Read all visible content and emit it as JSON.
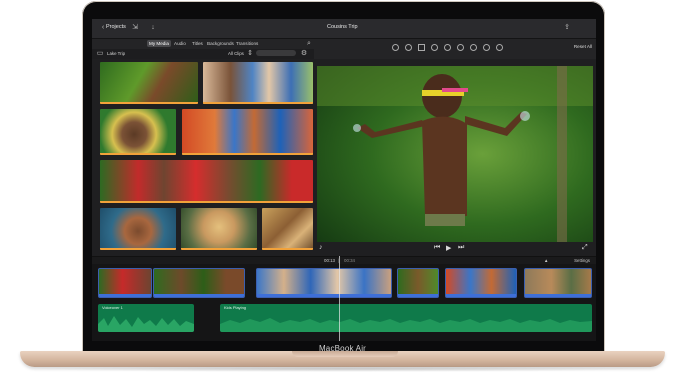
{
  "device": {
    "label": "MacBook Air"
  },
  "titlebar": {
    "back_label": "Projects",
    "project_title": "Cousins Trip",
    "reset_label": "Reset All"
  },
  "media_tabs": [
    "My Media",
    "Audio",
    "Titles",
    "Backgrounds",
    "Transitions"
  ],
  "library": {
    "name": "Lake Trip",
    "filter_label": "All Clips"
  },
  "playback": {
    "current": "00:13",
    "total": "00:34"
  },
  "timeline": {
    "settings_label": "Settings",
    "audio_tracks": [
      "Voiceover 1",
      "Kids Playing"
    ]
  },
  "colors": {
    "accent": "#f2a23a",
    "clip_border": "#3e6fd8",
    "audio": "#0f7a4a"
  }
}
